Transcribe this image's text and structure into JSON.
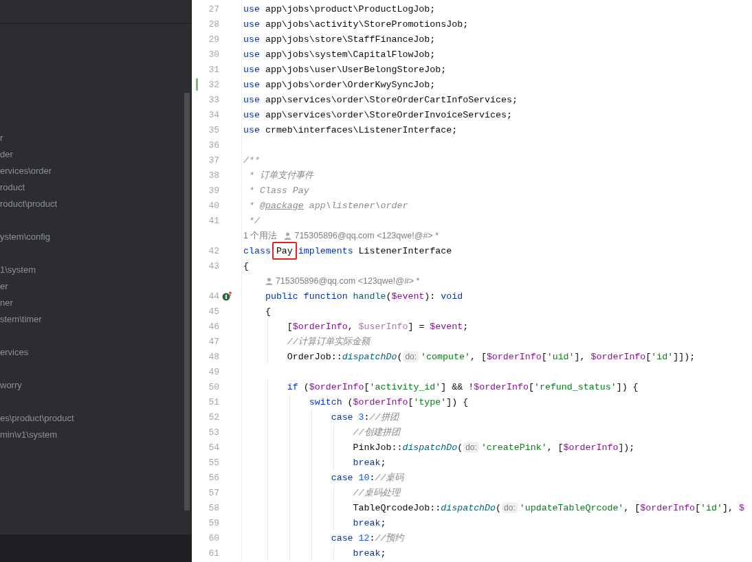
{
  "sidebar": {
    "groups": [
      [
        "r",
        "der",
        "ervices\\order",
        "roduct",
        "roduct\\product"
      ],
      [
        "ystem\\config"
      ],
      [
        "1\\system",
        "er",
        "ner",
        "stem\\timer"
      ],
      [
        "ervices"
      ],
      [
        "worry"
      ],
      [
        "es\\product\\product",
        "min\\v1\\system"
      ]
    ]
  },
  "editor": {
    "lines": [
      {
        "kind": "code",
        "number": "27",
        "tokens": [
          {
            "text": "use ",
            "kind": "kw"
          },
          {
            "text": "app\\jobs\\product\\ProductLogJob;",
            "kind": "plain"
          }
        ]
      },
      {
        "kind": "code",
        "number": "28",
        "tokens": [
          {
            "text": "use ",
            "kind": "kw"
          },
          {
            "text": "app\\jobs\\activity\\StorePromotionsJob;",
            "kind": "plain"
          }
        ]
      },
      {
        "kind": "code",
        "number": "29",
        "tokens": [
          {
            "text": "use ",
            "kind": "kw"
          },
          {
            "text": "app\\jobs\\store\\StaffFinanceJob;",
            "kind": "plain"
          }
        ]
      },
      {
        "kind": "code",
        "number": "30",
        "tokens": [
          {
            "text": "use ",
            "kind": "kw"
          },
          {
            "text": "app\\jobs\\system\\CapitalFlowJob;",
            "kind": "plain"
          }
        ]
      },
      {
        "kind": "code",
        "number": "31",
        "tokens": [
          {
            "text": "use ",
            "kind": "kw"
          },
          {
            "text": "app\\jobs\\user\\UserBelongStoreJob;",
            "kind": "plain"
          }
        ]
      },
      {
        "kind": "code",
        "number": "32",
        "changed": true,
        "tokens": [
          {
            "text": "use ",
            "kind": "kw"
          },
          {
            "text": "app\\jobs\\order\\OrderKwySyncJob;",
            "kind": "plain"
          }
        ]
      },
      {
        "kind": "code",
        "number": "33",
        "tokens": [
          {
            "text": "use ",
            "kind": "kw"
          },
          {
            "text": "app\\services\\order\\StoreOrderCartInfoServices;",
            "kind": "plain"
          }
        ]
      },
      {
        "kind": "code",
        "number": "34",
        "tokens": [
          {
            "text": "use ",
            "kind": "kw"
          },
          {
            "text": "app\\services\\order\\StoreOrderInvoiceServices;",
            "kind": "plain"
          }
        ]
      },
      {
        "kind": "code",
        "number": "35",
        "tokens": [
          {
            "text": "use ",
            "kind": "kw"
          },
          {
            "text": "crmeb\\interfaces\\ListenerInterface;",
            "kind": "plain"
          }
        ]
      },
      {
        "kind": "code",
        "number": "36"
      },
      {
        "kind": "code",
        "number": "37",
        "tokens": [
          {
            "text": "/**",
            "kind": "doc"
          }
        ]
      },
      {
        "kind": "code",
        "number": "38",
        "tokens": [
          {
            "text": " * 订单支付事件",
            "kind": "doc"
          }
        ]
      },
      {
        "kind": "code",
        "number": "39",
        "tokens": [
          {
            "text": " * Class Pay",
            "kind": "doc"
          }
        ]
      },
      {
        "kind": "code",
        "number": "40",
        "tokens": [
          {
            "text": " * ",
            "kind": "doc"
          },
          {
            "text": "@package",
            "kind": "doctag"
          },
          {
            "text": " app\\listener\\order",
            "kind": "doc"
          }
        ]
      },
      {
        "kind": "code",
        "number": "41",
        "tokens": [
          {
            "text": " */",
            "kind": "doc"
          }
        ]
      },
      {
        "kind": "hint",
        "usages": "1 个用法",
        "author": "715305896@qq.com <123qwe!@#> *"
      },
      {
        "kind": "code",
        "number": "42",
        "tokens": [
          {
            "text": "class ",
            "kind": "kw"
          },
          {
            "text": "Pay",
            "kind": "plain",
            "boxed": true
          },
          {
            "text": " implements",
            "kind": "kw"
          },
          {
            "text": " ListenerInterface",
            "kind": "plain"
          }
        ]
      },
      {
        "kind": "code",
        "number": "43",
        "tokens": [
          {
            "text": "{",
            "kind": "plain"
          }
        ]
      },
      {
        "kind": "hint",
        "author": "715305896@qq.com <123qwe!@#> *"
      },
      {
        "kind": "code",
        "number": "44",
        "implemented": true,
        "tokens": [
          {
            "text": "    public function ",
            "kind": "kw"
          },
          {
            "text": "handle",
            "kind": "decl"
          },
          {
            "text": "(",
            "kind": "plain"
          },
          {
            "text": "$event",
            "kind": "var"
          },
          {
            "text": "): ",
            "kind": "plain"
          },
          {
            "text": "void",
            "kind": "kw"
          }
        ]
      },
      {
        "kind": "code",
        "number": "45",
        "tokens": [
          {
            "text": "    {",
            "kind": "plain"
          }
        ]
      },
      {
        "kind": "code",
        "number": "46",
        "tokens": [
          {
            "text": "        [",
            "kind": "plain"
          },
          {
            "text": "$orderInfo",
            "kind": "var"
          },
          {
            "text": ", ",
            "kind": "plain"
          },
          {
            "text": "$userInfo",
            "kind": "unused"
          },
          {
            "text": "] = ",
            "kind": "plain"
          },
          {
            "text": "$event",
            "kind": "var"
          },
          {
            "text": ";",
            "kind": "plain"
          }
        ]
      },
      {
        "kind": "code",
        "number": "47",
        "tokens": [
          {
            "text": "        //计算订单实际金额",
            "kind": "comment"
          }
        ]
      },
      {
        "kind": "code",
        "number": "48",
        "tokens": [
          {
            "text": "        OrderJob::",
            "kind": "plain"
          },
          {
            "text": "dispatchDo",
            "kind": "call"
          },
          {
            "text": "(",
            "kind": "plain"
          },
          {
            "text": "do:",
            "kind": "inlay"
          },
          {
            "text": "'compute'",
            "kind": "str"
          },
          {
            "text": ", [",
            "kind": "plain"
          },
          {
            "text": "$orderInfo",
            "kind": "var"
          },
          {
            "text": "[",
            "kind": "plain"
          },
          {
            "text": "'uid'",
            "kind": "str"
          },
          {
            "text": "], ",
            "kind": "plain"
          },
          {
            "text": "$orderInfo",
            "kind": "var"
          },
          {
            "text": "[",
            "kind": "plain"
          },
          {
            "text": "'id'",
            "kind": "str"
          },
          {
            "text": "]]);",
            "kind": "plain"
          }
        ]
      },
      {
        "kind": "code",
        "number": "49"
      },
      {
        "kind": "code",
        "number": "50",
        "tokens": [
          {
            "text": "        if",
            "kind": "kw"
          },
          {
            "text": " (",
            "kind": "plain"
          },
          {
            "text": "$orderInfo",
            "kind": "var"
          },
          {
            "text": "[",
            "kind": "plain"
          },
          {
            "text": "'activity_id'",
            "kind": "str"
          },
          {
            "text": "] && !",
            "kind": "plain"
          },
          {
            "text": "$orderInfo",
            "kind": "var"
          },
          {
            "text": "[",
            "kind": "plain"
          },
          {
            "text": "'refund_status'",
            "kind": "str"
          },
          {
            "text": "]) {",
            "kind": "plain"
          }
        ]
      },
      {
        "kind": "code",
        "number": "51",
        "tokens": [
          {
            "text": "            switch",
            "kind": "kw"
          },
          {
            "text": " (",
            "kind": "plain"
          },
          {
            "text": "$orderInfo",
            "kind": "var"
          },
          {
            "text": "[",
            "kind": "plain"
          },
          {
            "text": "'type'",
            "kind": "str"
          },
          {
            "text": "]) {",
            "kind": "plain"
          }
        ]
      },
      {
        "kind": "code",
        "number": "52",
        "tokens": [
          {
            "text": "                case ",
            "kind": "kw"
          },
          {
            "text": "3",
            "kind": "num"
          },
          {
            "text": ":",
            "kind": "plain"
          },
          {
            "text": "//拼团",
            "kind": "comment"
          }
        ]
      },
      {
        "kind": "code",
        "number": "53",
        "tokens": [
          {
            "text": "                    //创建拼团",
            "kind": "comment"
          }
        ]
      },
      {
        "kind": "code",
        "number": "54",
        "tokens": [
          {
            "text": "                    PinkJob::",
            "kind": "plain"
          },
          {
            "text": "dispatchDo",
            "kind": "call"
          },
          {
            "text": "(",
            "kind": "plain"
          },
          {
            "text": "do:",
            "kind": "inlay"
          },
          {
            "text": "'createPink'",
            "kind": "str"
          },
          {
            "text": ", [",
            "kind": "plain"
          },
          {
            "text": "$orderInfo",
            "kind": "var"
          },
          {
            "text": "]);",
            "kind": "plain"
          }
        ]
      },
      {
        "kind": "code",
        "number": "55",
        "tokens": [
          {
            "text": "                    break",
            "kind": "kw"
          },
          {
            "text": ";",
            "kind": "plain"
          }
        ]
      },
      {
        "kind": "code",
        "number": "56",
        "tokens": [
          {
            "text": "                case ",
            "kind": "kw"
          },
          {
            "text": "10",
            "kind": "num"
          },
          {
            "text": ":",
            "kind": "plain"
          },
          {
            "text": "//桌码",
            "kind": "comment"
          }
        ]
      },
      {
        "kind": "code",
        "number": "57",
        "tokens": [
          {
            "text": "                    //桌码处理",
            "kind": "comment"
          }
        ]
      },
      {
        "kind": "code",
        "number": "58",
        "tokens": [
          {
            "text": "                    TableQrcodeJob::",
            "kind": "plain"
          },
          {
            "text": "dispatchDo",
            "kind": "call"
          },
          {
            "text": "(",
            "kind": "plain"
          },
          {
            "text": "do:",
            "kind": "inlay"
          },
          {
            "text": "'updateTableQrcode'",
            "kind": "str"
          },
          {
            "text": ", [",
            "kind": "plain"
          },
          {
            "text": "$orderInfo",
            "kind": "var"
          },
          {
            "text": "[",
            "kind": "plain"
          },
          {
            "text": "'id'",
            "kind": "str"
          },
          {
            "text": "], ",
            "kind": "plain"
          },
          {
            "text": "$",
            "kind": "var"
          }
        ]
      },
      {
        "kind": "code",
        "number": "59",
        "tokens": [
          {
            "text": "                    break",
            "kind": "kw"
          },
          {
            "text": ";",
            "kind": "plain"
          }
        ]
      },
      {
        "kind": "code",
        "number": "60",
        "tokens": [
          {
            "text": "                case ",
            "kind": "kw"
          },
          {
            "text": "12",
            "kind": "num"
          },
          {
            "text": ":",
            "kind": "plain"
          },
          {
            "text": "//预约",
            "kind": "comment"
          }
        ]
      },
      {
        "kind": "code",
        "number": "61",
        "tokens": [
          {
            "text": "                    break",
            "kind": "kw"
          },
          {
            "text": ";",
            "kind": "plain"
          }
        ]
      }
    ]
  }
}
